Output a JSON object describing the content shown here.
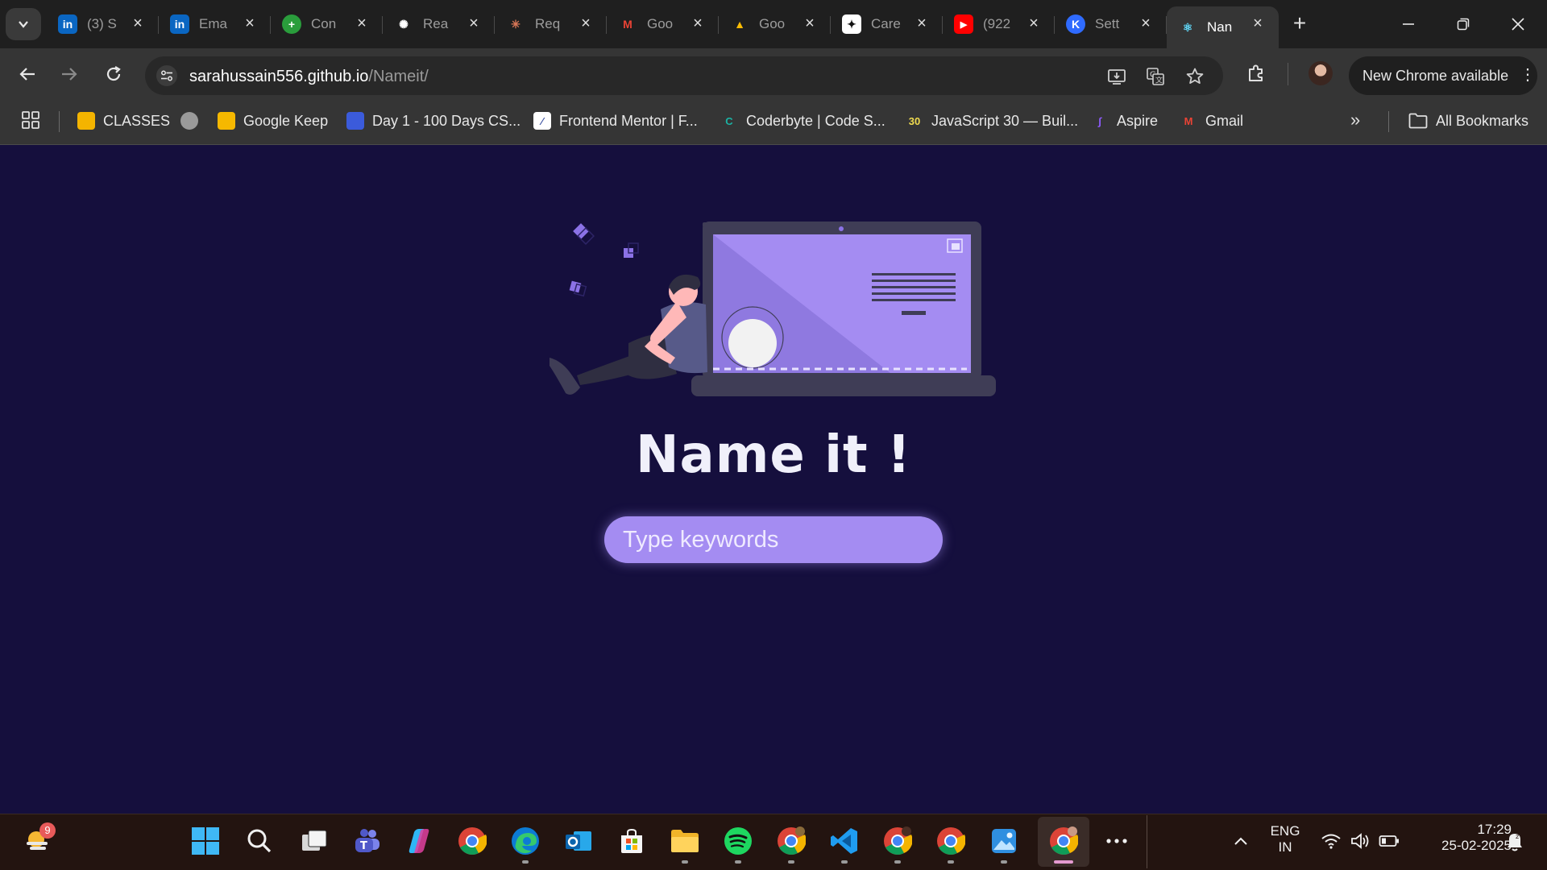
{
  "browser": {
    "tabs": [
      {
        "title": "(3) S",
        "icon": "linkedin-icon",
        "color": "#0a66c2",
        "glyph": "in"
      },
      {
        "title": "Ema",
        "icon": "linkedin-icon",
        "color": "#0a66c2",
        "glyph": "in"
      },
      {
        "title": "Con",
        "icon": "plus-circle-icon",
        "color": "#2a9d3c",
        "glyph": "+"
      },
      {
        "title": "Rea",
        "icon": "openai-icon",
        "color": "#ffffff",
        "glyph": "✺"
      },
      {
        "title": "Req",
        "icon": "claude-icon",
        "color": "#d97757",
        "glyph": "✳"
      },
      {
        "title": "Goo",
        "icon": "gmail-icon",
        "color": "#ea4335",
        "glyph": "M"
      },
      {
        "title": "Goo",
        "icon": "google-ads-icon",
        "color": "#fbbc04",
        "glyph": "▲"
      },
      {
        "title": "Care",
        "icon": "sparkle-icon",
        "color": "#ffffff",
        "glyph": "✦"
      },
      {
        "title": "(922",
        "icon": "youtube-icon",
        "color": "#ff0000",
        "glyph": "▶"
      },
      {
        "title": "Sett",
        "icon": "settings-logo-icon",
        "color": "#2f6bff",
        "glyph": "K"
      },
      {
        "title": "Nan",
        "icon": "react-icon",
        "color": "#61dafb",
        "glyph": "⚛",
        "active": true
      }
    ],
    "url_host": "sarahussain556.github.io",
    "url_path": "/Nameit/",
    "update_label": "New Chrome available",
    "bookmarks": [
      {
        "label": "CLASSES",
        "icon": "google-classroom-icon",
        "color": "#f4b400"
      },
      {
        "label": "",
        "icon": "globe-icon",
        "color": "#6a6a6a"
      },
      {
        "label": "Google Keep",
        "icon": "google-keep-icon",
        "color": "#f6b800"
      },
      {
        "label": "Day 1 - 100 Days CS...",
        "icon": "course-icon",
        "color": "#3b5bdb"
      },
      {
        "label": "Frontend Mentor | F...",
        "icon": "frontend-mentor-icon",
        "color": "#ffffff"
      },
      {
        "label": "Coderbyte | Code S...",
        "icon": "coderbyte-icon",
        "color": "#1bb3a4"
      },
      {
        "label": "JavaScript 30 — Buil...",
        "icon": "js30-icon",
        "color": "#2a2a2a"
      },
      {
        "label": "Aspire",
        "icon": "aspire-icon",
        "color": "#8e5bff"
      },
      {
        "label": "Gmail",
        "icon": "gmail-icon",
        "color": "#ea4335"
      }
    ],
    "all_bookmarks_label": "All Bookmarks"
  },
  "page": {
    "title": "Name it !",
    "search_placeholder": "Type keywords",
    "colors": {
      "background": "#150f3d",
      "accent": "#a48cf2"
    }
  },
  "taskbar": {
    "weather_badge": "9",
    "language_line1": "ENG",
    "language_line2": "IN",
    "time": "17:29",
    "date": "25-02-2025"
  }
}
